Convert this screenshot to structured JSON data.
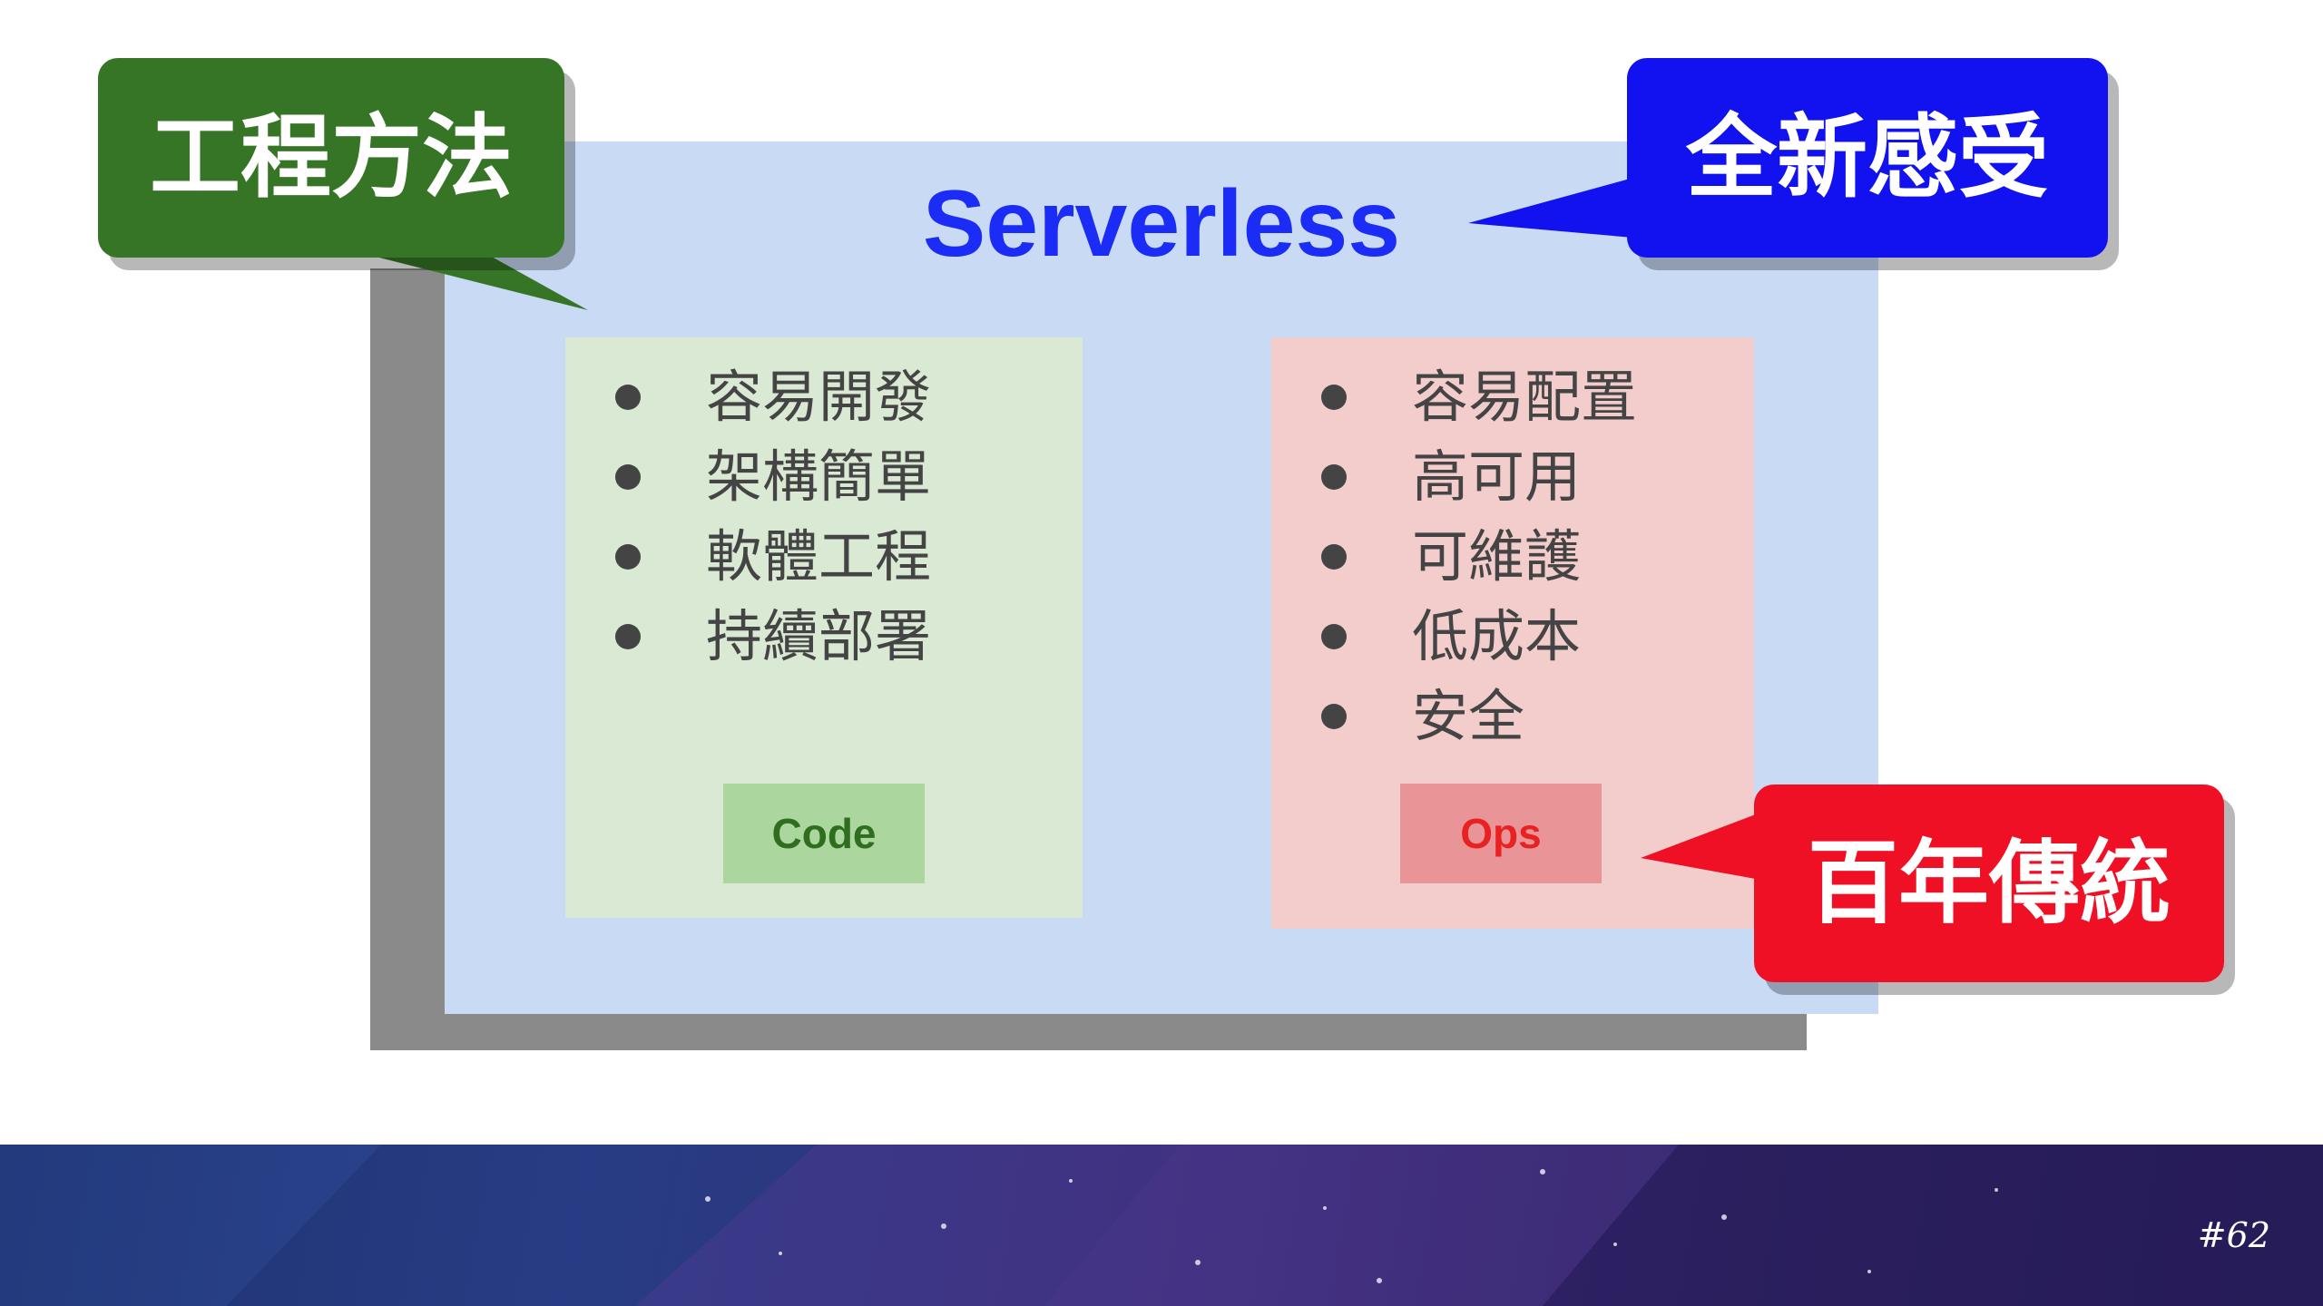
{
  "title": "Serverless",
  "callouts": {
    "engineering": "工程方法",
    "novelty": "全新感受",
    "tradition": "百年傳統"
  },
  "code_panel": {
    "items": [
      "容易開發",
      "架構簡單",
      "軟體工程",
      "持續部署"
    ],
    "tag": "Code"
  },
  "ops_panel": {
    "items": [
      "容易配置",
      "高可用",
      "可維護",
      "低成本",
      "安全"
    ],
    "tag": "Ops"
  },
  "slide_number": "#62",
  "colors": {
    "title": "#1a2cf5",
    "green_callout": "#377526",
    "blue_callout": "#1112ef",
    "red_callout": "#f01025",
    "code_panel": "#d9e9d3",
    "ops_panel": "#f3cccc",
    "main_box": "#c9daf5"
  }
}
